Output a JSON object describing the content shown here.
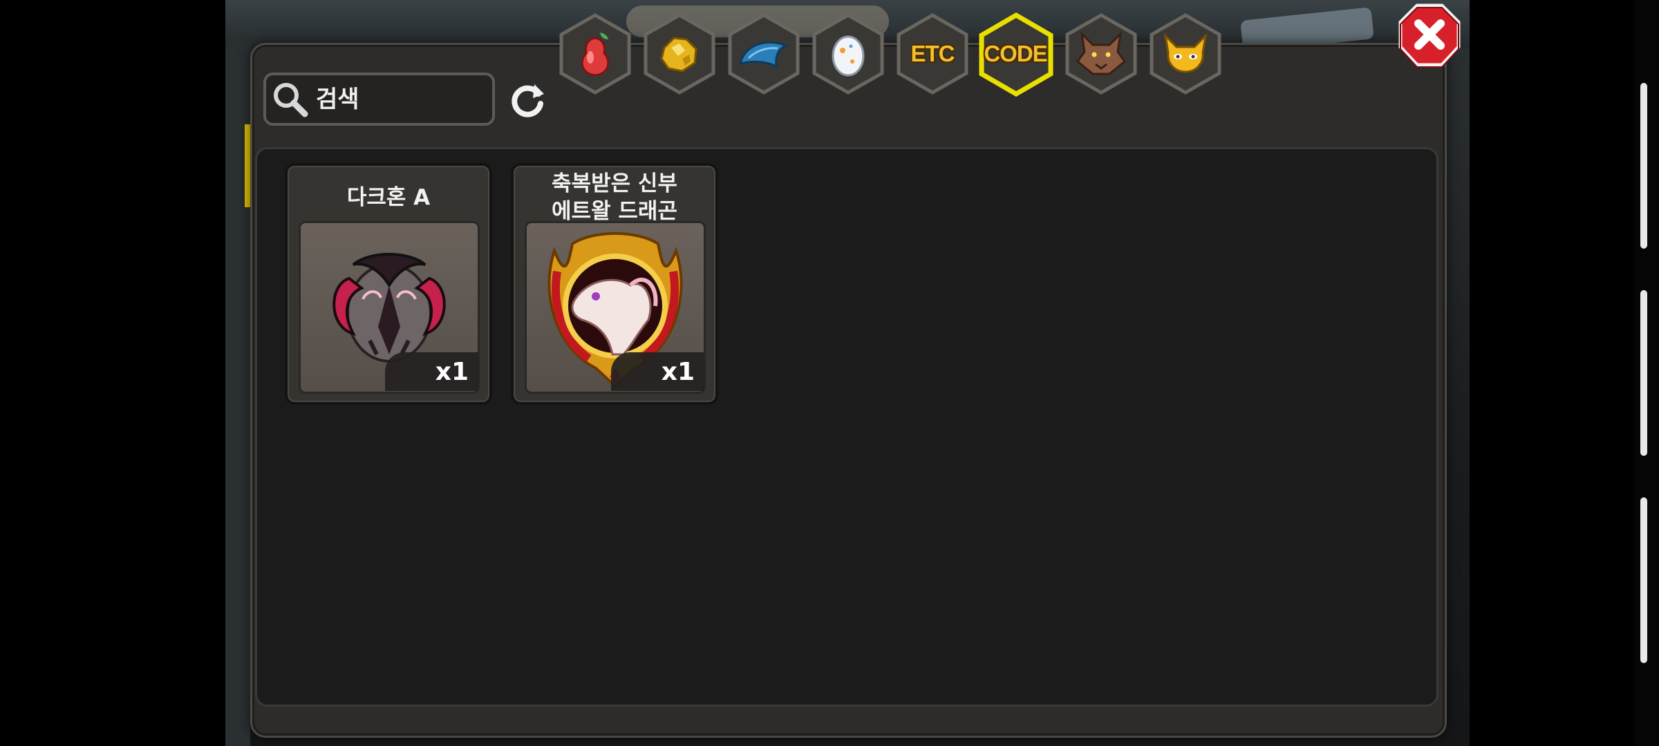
{
  "search": {
    "placeholder": "검색"
  },
  "tabs": [
    {
      "id": "fruit",
      "icon": "pear-icon",
      "label": ""
    },
    {
      "id": "gold",
      "icon": "gold-nugget-icon",
      "label": ""
    },
    {
      "id": "material",
      "icon": "blue-scale-icon",
      "label": ""
    },
    {
      "id": "egg",
      "icon": "egg-icon",
      "label": ""
    },
    {
      "id": "etc",
      "icon": "etc-text-icon",
      "label": "ETC"
    },
    {
      "id": "code",
      "icon": "code-text-icon",
      "label": "CODE",
      "selected": true
    },
    {
      "id": "beast",
      "icon": "wolf-head-icon",
      "label": ""
    },
    {
      "id": "monster",
      "icon": "horned-mask-icon",
      "label": ""
    }
  ],
  "items": [
    {
      "name": "다크혼 A",
      "quantity": "x1",
      "icon": "dark-horn-egg-icon"
    },
    {
      "name": "축복받은 신부\n에트왈 드래곤",
      "quantity": "x1",
      "icon": "blessed-bride-dragon-icon"
    }
  ],
  "colors": {
    "selected_tab_outline": "#e9e000",
    "close_button": "#d8202a",
    "tab_text": "#f0c030"
  }
}
